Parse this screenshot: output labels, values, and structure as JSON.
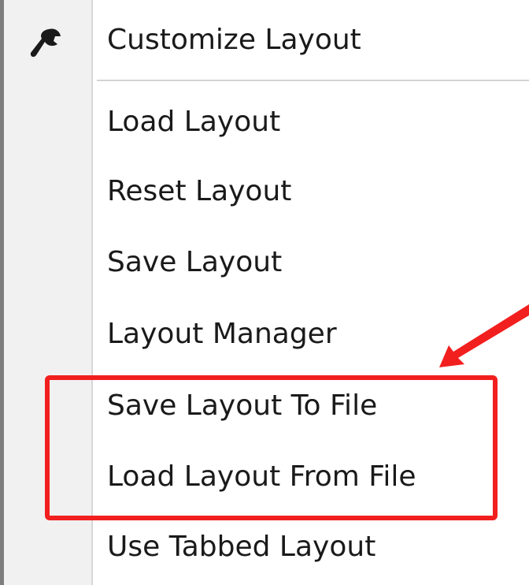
{
  "menu": {
    "items": [
      {
        "label": "Customize Layout",
        "icon": "wrench-icon"
      },
      {
        "label": "Load Layout"
      },
      {
        "label": "Reset Layout"
      },
      {
        "label": "Save Layout"
      },
      {
        "label": "Layout Manager"
      },
      {
        "label": "Save Layout To File"
      },
      {
        "label": "Load Layout From File"
      },
      {
        "label": "Use Tabbed Layout"
      }
    ]
  },
  "annotation": {
    "highlight_color": "#f21f1f",
    "arrow_color": "#f21f1f"
  }
}
